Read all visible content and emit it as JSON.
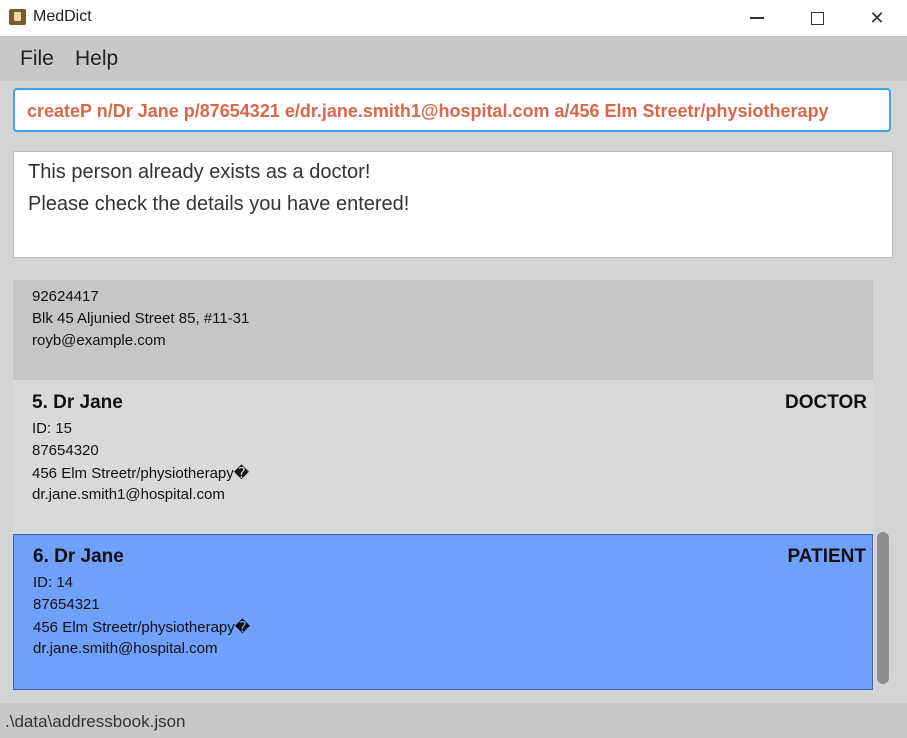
{
  "window": {
    "title": "MedDict",
    "minimize_glyph": "—",
    "close_glyph": "✕"
  },
  "menu": {
    "file": "File",
    "help": "Help"
  },
  "command": {
    "value": "createP n/Dr Jane p/87654321 e/dr.jane.smith1@hospital.com a/456 Elm Streetr/physiotherapy"
  },
  "result": {
    "line1": "This person already exists as a doctor!",
    "line2": "Please check the details you have entered!"
  },
  "persons": [
    {
      "phone": "92624417",
      "address": "Blk 45 Aljunied Street 85, #11-31",
      "email": "royb@example.com"
    },
    {
      "name": "5.  Dr Jane",
      "role": "DOCTOR",
      "id": "ID: 15",
      "phone": "87654320",
      "address": "456 Elm Streetr/physiotherapy�",
      "email": "dr.jane.smith1@hospital.com"
    },
    {
      "name": "6.  Dr Jane",
      "role": "PATIENT",
      "id": "ID: 14",
      "phone": "87654321",
      "address": "456 Elm Streetr/physiotherapy�",
      "email": "dr.jane.smith@hospital.com"
    }
  ],
  "status": {
    "path": ".\\data\\addressbook.json"
  },
  "colors": {
    "accent_border": "#3aa7e8",
    "command_text": "#d9674a",
    "selected_card": "#6ea0fc"
  }
}
